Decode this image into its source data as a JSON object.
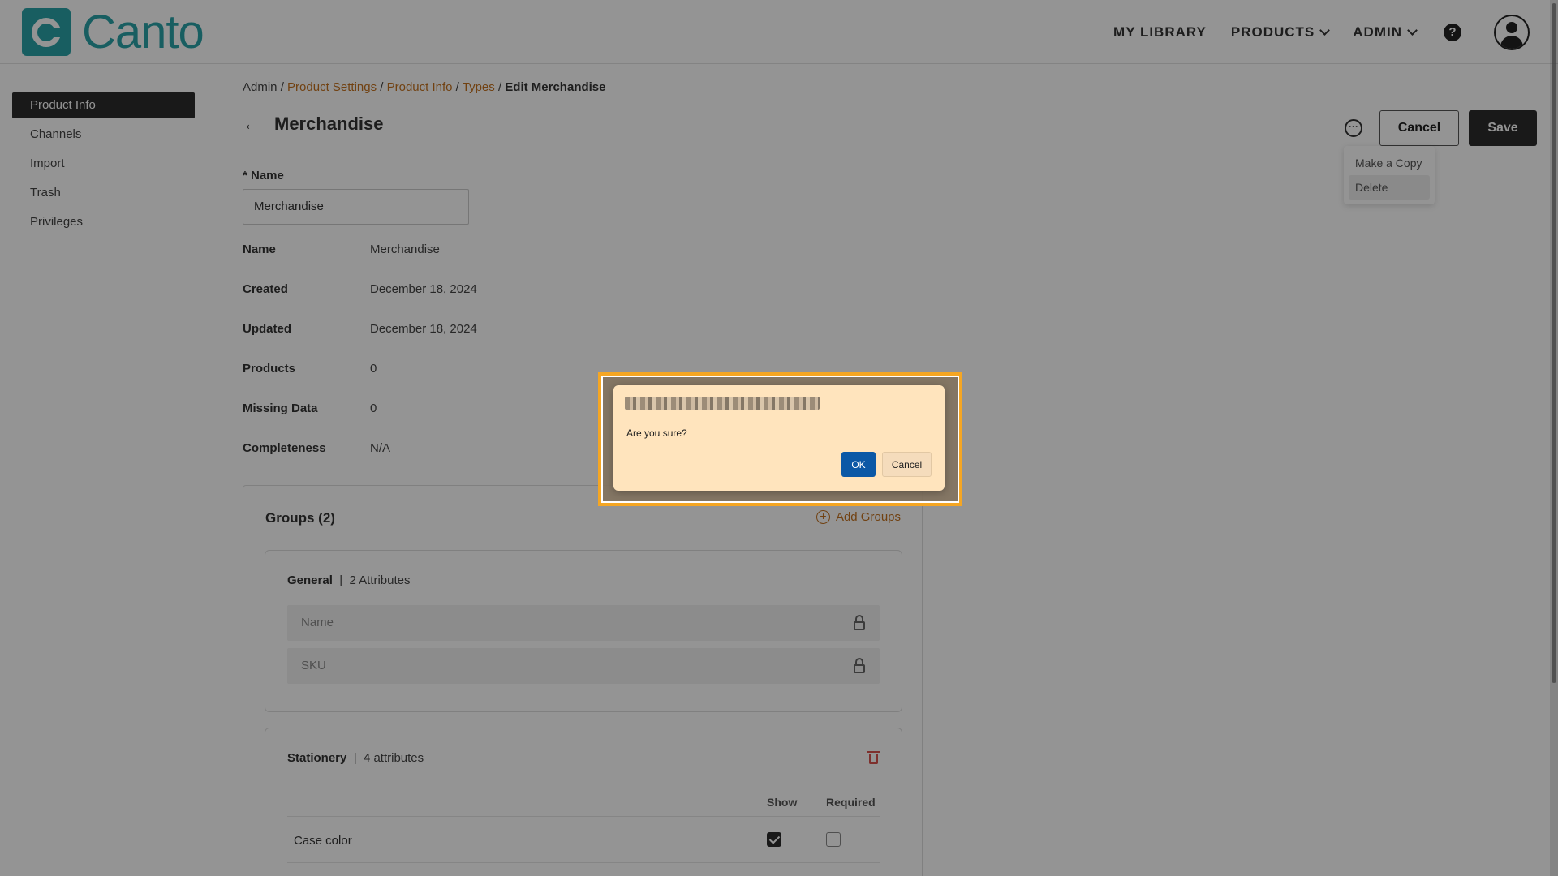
{
  "header": {
    "logo_text": "Canto",
    "nav": [
      "MY LIBRARY",
      "PRODUCTS",
      "ADMIN"
    ],
    "help_glyph": "?"
  },
  "sidebar": {
    "items": [
      {
        "label": "Product Info",
        "active": true
      },
      {
        "label": "Channels"
      },
      {
        "label": "Import"
      },
      {
        "label": "Trash"
      },
      {
        "label": "Privileges"
      }
    ]
  },
  "breadcrumb": {
    "root": "Admin",
    "links": [
      "Product Settings",
      "Product Info",
      "Types"
    ],
    "current": "Edit Merchandise",
    "separator": " / "
  },
  "page": {
    "back_glyph": "←",
    "title": "Merchandise",
    "more_glyph": "···",
    "cancel_label": "Cancel",
    "save_label": "Save"
  },
  "more_menu": {
    "items": [
      "Make a Copy",
      "Delete"
    ]
  },
  "form": {
    "name_label": "* Name",
    "name_value": "Merchandise"
  },
  "info": [
    {
      "key": "Name",
      "value": "Merchandise"
    },
    {
      "key": "Created",
      "value": "December 18, 2024"
    },
    {
      "key": "Updated",
      "value": "December 18, 2024"
    },
    {
      "key": "Products",
      "value": "0"
    },
    {
      "key": "Missing Data",
      "value": "0"
    },
    {
      "key": "Completeness",
      "value": "N/A"
    }
  ],
  "groups": {
    "title": "Groups (2)",
    "add_label": "Add Groups",
    "add_glyph": "+",
    "general": {
      "name": "General",
      "count": "2 Attributes",
      "attributes": [
        "Name",
        "SKU"
      ]
    },
    "stationery": {
      "name": "Stationery",
      "count": "4 attributes",
      "col_show": "Show",
      "col_required": "Required",
      "rows": [
        {
          "name": "Case color",
          "show": true,
          "required": false
        }
      ]
    }
  },
  "dialog": {
    "message": "Are you sure?",
    "ok_label": "OK",
    "cancel_label": "Cancel"
  },
  "colors": {
    "brand": "#2aa3a8",
    "link": "#c3711e",
    "primary_button": "#0b58a6",
    "dialog_bg": "#ffe4bd",
    "highlight": "#f5a623"
  }
}
